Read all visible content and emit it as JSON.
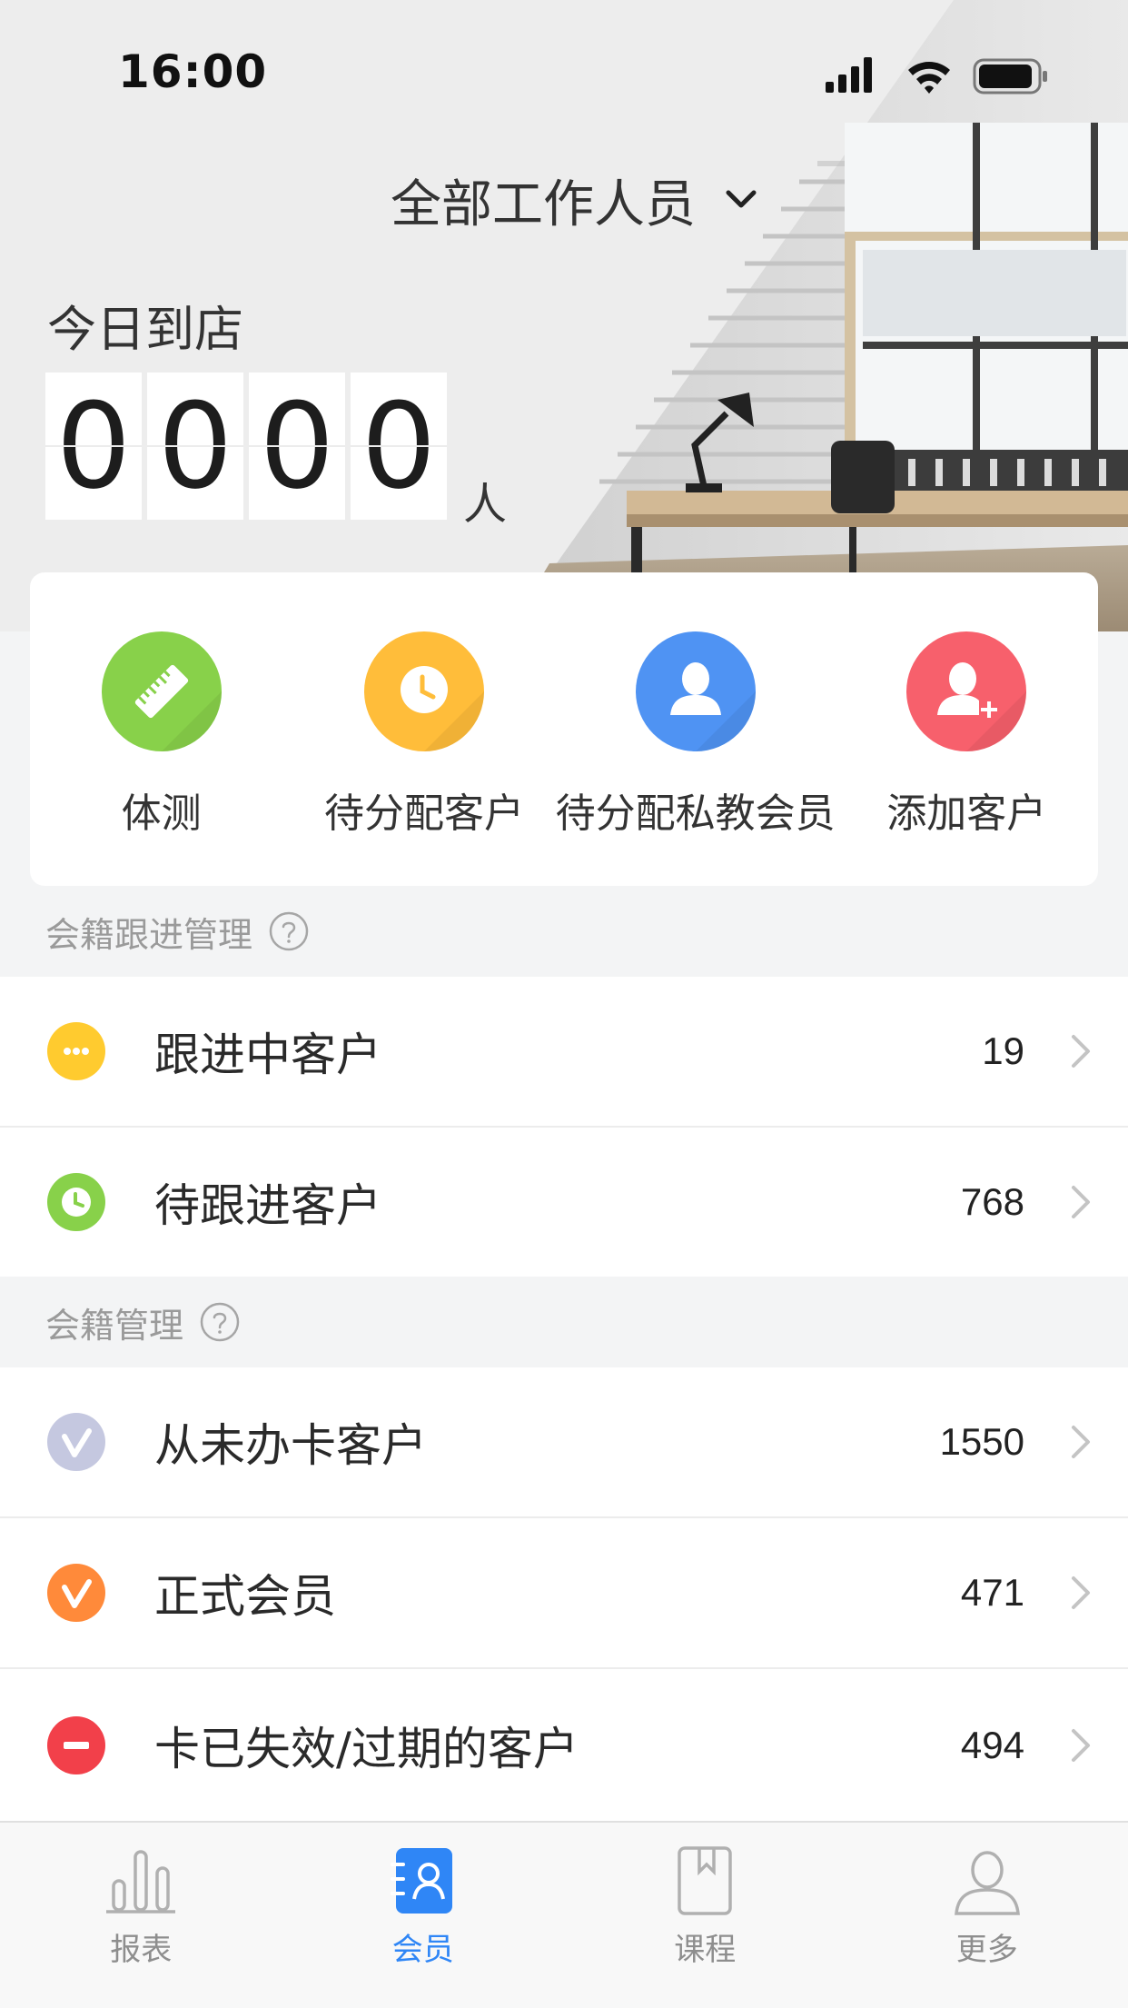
{
  "status_bar": {
    "time": "16:00"
  },
  "header": {
    "staff_filter": "全部工作人员",
    "today_label": "今日到店",
    "count_digits": [
      "0",
      "0",
      "0",
      "0"
    ],
    "count_unit": "人"
  },
  "quick_actions": [
    {
      "label": "体测",
      "icon": "ruler-icon",
      "color": "#88d14a"
    },
    {
      "label": "待分配客户",
      "icon": "clock-icon",
      "color": "#ffbd3a"
    },
    {
      "label": "待分配私教会员",
      "icon": "person-icon",
      "color": "#4f93f3"
    },
    {
      "label": "添加客户",
      "icon": "add-person-icon",
      "color": "#f7606c"
    }
  ],
  "follow_section": {
    "title": "会籍跟进管理",
    "rows": [
      {
        "label": "跟进中客户",
        "count": "19",
        "icon": "more-dots-icon",
        "color": "#ffcb2f"
      },
      {
        "label": "待跟进客户",
        "count": "768",
        "icon": "clock-icon",
        "color": "#88d14a"
      }
    ]
  },
  "membership_section": {
    "title": "会籍管理",
    "rows": [
      {
        "label": "从未办卡客户",
        "count": "1550",
        "icon": "v-badge-icon",
        "color": "#c5c8e0"
      },
      {
        "label": "正式会员",
        "count": "471",
        "icon": "v-badge-icon",
        "color": "#ff8a3a"
      },
      {
        "label": "卡已失效/过期的客户",
        "count": "494",
        "icon": "minus-circle-icon",
        "color": "#f2404a"
      }
    ]
  },
  "tabbar": {
    "active_color": "#2f86f6",
    "tabs": [
      {
        "label": "报表",
        "icon": "bar-chart-icon"
      },
      {
        "label": "会员",
        "icon": "member-card-icon"
      },
      {
        "label": "课程",
        "icon": "book-icon"
      },
      {
        "label": "更多",
        "icon": "user-outline-icon"
      }
    ]
  }
}
